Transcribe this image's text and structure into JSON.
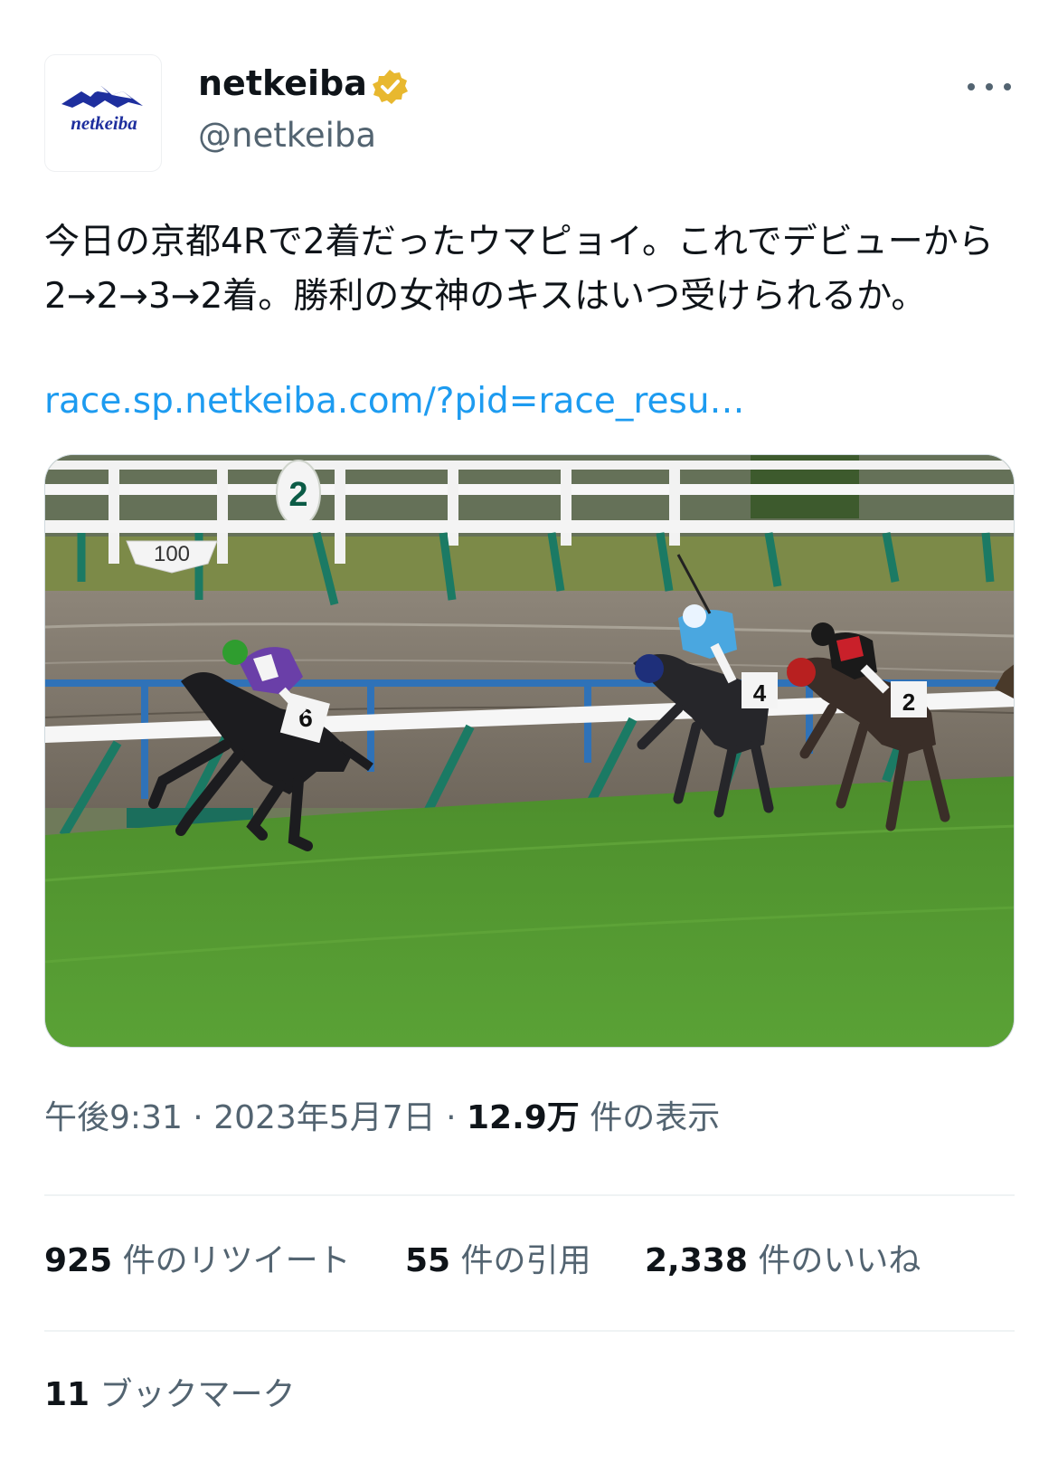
{
  "author": {
    "logo_text": "netkeiba",
    "display_name": "netkeiba",
    "handle": "@netkeiba",
    "verified": true,
    "badge_color": "#e8b82f"
  },
  "tweet": {
    "text": "今日の京都4Rで2着だったウマピョイ。これでデビューから2→2→3→2着。勝利の女神のキスはいつ受けられるか。",
    "link_text": "race.sp.netkeiba.com/?pid=race_resu…",
    "media": {
      "distance_marker": "100",
      "pole_number": "2",
      "saddle_cloth_numbers": [
        "6",
        "4",
        "2"
      ]
    }
  },
  "meta": {
    "time": "午後9:31",
    "separator1": " · ",
    "date": "2023年5月7日",
    "separator2": " · ",
    "views_count": "12.9万",
    "views_label": " 件の表示"
  },
  "stats": {
    "retweets_count": "925",
    "retweets_label": " 件のリツイート",
    "quotes_count": "55",
    "quotes_label": " 件の引用",
    "likes_count": "2,338",
    "likes_label": " 件のいいね",
    "bookmarks_count": "11",
    "bookmarks_label": " ブックマーク"
  },
  "colors": {
    "link": "#1d9bf0",
    "secondary_text": "#536471",
    "primary_text": "#0f1419"
  }
}
